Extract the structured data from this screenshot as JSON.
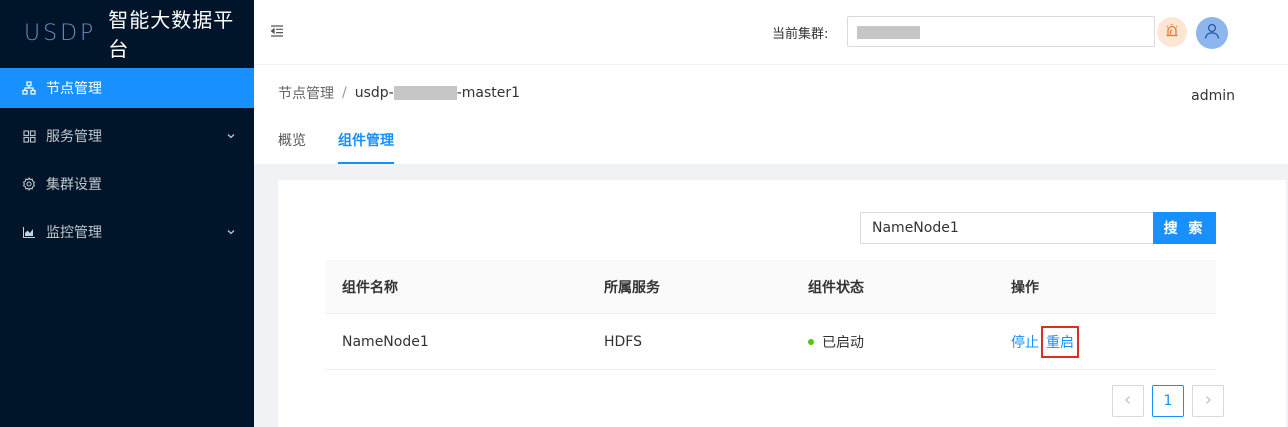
{
  "app": {
    "logo_mark": "USDP",
    "title": "智能大数据平台"
  },
  "sidebar": {
    "items": [
      {
        "label": "节点管理",
        "icon": "cluster-icon",
        "active": true
      },
      {
        "label": "服务管理",
        "icon": "grid-icon",
        "has_children": true
      },
      {
        "label": "集群设置",
        "icon": "gear-icon"
      },
      {
        "label": "监控管理",
        "icon": "area-chart-icon",
        "has_children": true
      }
    ]
  },
  "header": {
    "cluster_label": "当前集群:",
    "user_name": "admin"
  },
  "breadcrumb": {
    "root": "节点管理",
    "separator": "/",
    "current_prefix": "usdp-",
    "current_suffix": "-master1"
  },
  "tabs": [
    {
      "label": "概览",
      "active": false
    },
    {
      "label": "组件管理",
      "active": true
    }
  ],
  "search": {
    "value": "NameNode1",
    "button_label": "搜 索"
  },
  "table": {
    "columns": [
      "组件名称",
      "所属服务",
      "组件状态",
      "操作"
    ],
    "rows": [
      {
        "name": "NameNode1",
        "service": "HDFS",
        "status": "已启动",
        "actions": [
          "停止",
          "重启"
        ]
      }
    ]
  },
  "pagination": {
    "current": "1"
  },
  "colors": {
    "primary": "#1890ff",
    "sidebar_bg": "#001529",
    "status_ok": "#52c41a",
    "highlight": "#d93025"
  }
}
